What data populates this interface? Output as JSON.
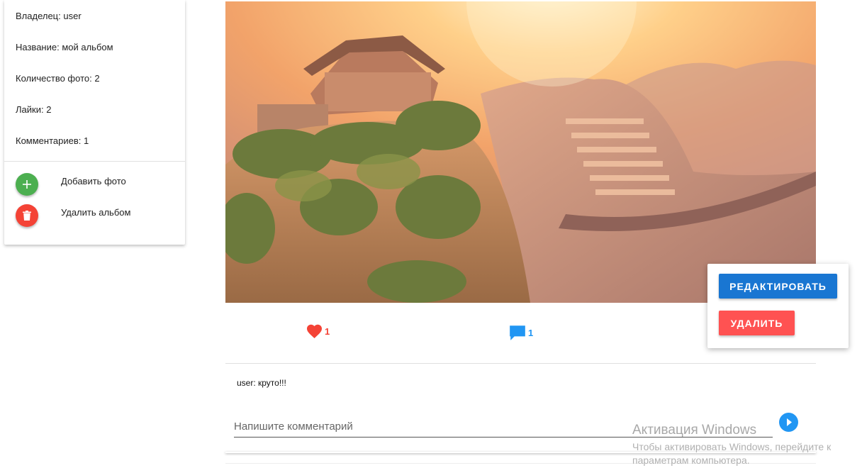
{
  "album_info": {
    "owner": "Владелец: user",
    "name": "Название: мой альбом",
    "photo_count": "Количество фото: 2",
    "likes": "Лайки: 2",
    "comments": "Комментариев: 1"
  },
  "actions": {
    "add_photo_label": "Добавить фото",
    "delete_album_label": "Удалить альбом",
    "add_icon": "plus-icon",
    "delete_icon": "trash-icon"
  },
  "photo": {
    "subject": "great-wall-photo"
  },
  "stats": {
    "likes_count": "1",
    "comments_count": "1",
    "likes_icon": "heart-icon",
    "comments_icon": "comment-icon"
  },
  "comments_section": {
    "items": [
      {
        "text": "user: круто!!!"
      }
    ],
    "input_placeholder": "Напишите комментарий",
    "send_icon": "send-icon"
  },
  "menu": {
    "edit_label": "РЕДАКТИРОВАТЬ",
    "delete_label": "УДАЛИТЬ"
  },
  "watermark": {
    "title": "Активация Windows",
    "subtitle": "Чтобы активировать Windows, перейдите к параметрам компьютера."
  },
  "colors": {
    "green": "#4caf50",
    "red": "#f44336",
    "blue": "#2196f3",
    "edit_button": "#1976d2",
    "delete_button": "#ff5252"
  }
}
